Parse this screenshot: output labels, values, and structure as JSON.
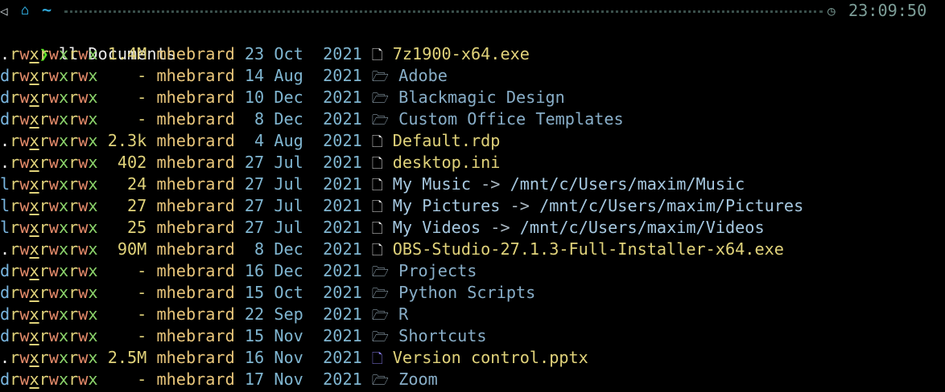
{
  "prompt": {
    "os_icon": "linux-icon",
    "home_icon": "home-icon",
    "cwd": "~",
    "time": "23:09:50",
    "clock_icon": "clock-icon",
    "chevron": "❯",
    "command": "ll Documents"
  },
  "columns": [
    "permissions",
    "size",
    "owner",
    "day",
    "month",
    "year",
    "icon",
    "name"
  ],
  "rows": [
    {
      "type": ".",
      "perms": "rwxrwxrwx",
      "size": "1.4M",
      "owner": "mhebrard",
      "day": "23",
      "month": "Oct",
      "year": "2021",
      "icon": "file-icon",
      "name": "7z1900-x64.exe",
      "kind": "file",
      "target": ""
    },
    {
      "type": "d",
      "perms": "rwxrwxrwx",
      "size": "-",
      "owner": "mhebrard",
      "day": "14",
      "month": "Aug",
      "year": "2021",
      "icon": "folder-icon",
      "name": "Adobe",
      "kind": "dir",
      "target": ""
    },
    {
      "type": "d",
      "perms": "rwxrwxrwx",
      "size": "-",
      "owner": "mhebrard",
      "day": "10",
      "month": "Dec",
      "year": "2021",
      "icon": "folder-icon",
      "name": "Blackmagic Design",
      "kind": "dir",
      "target": ""
    },
    {
      "type": "d",
      "perms": "rwxrwxrwx",
      "size": "-",
      "owner": "mhebrard",
      "day": "8",
      "month": "Dec",
      "year": "2021",
      "icon": "folder-icon",
      "name": "Custom Office Templates",
      "kind": "dir",
      "target": ""
    },
    {
      "type": ".",
      "perms": "rwxrwxrwx",
      "size": "2.3k",
      "owner": "mhebrard",
      "day": "4",
      "month": "Aug",
      "year": "2021",
      "icon": "file-icon",
      "name": "Default.rdp",
      "kind": "file",
      "target": ""
    },
    {
      "type": ".",
      "perms": "rwxrwxrwx",
      "size": "402",
      "owner": "mhebrard",
      "day": "27",
      "month": "Jul",
      "year": "2021",
      "icon": "file-icon",
      "name": "desktop.ini",
      "kind": "file",
      "target": ""
    },
    {
      "type": "l",
      "perms": "rwxrwxrwx",
      "size": "24",
      "owner": "mhebrard",
      "day": "27",
      "month": "Jul",
      "year": "2021",
      "icon": "file-icon",
      "name": "My Music",
      "kind": "link",
      "target": "/mnt/c/Users/maxim/Music"
    },
    {
      "type": "l",
      "perms": "rwxrwxrwx",
      "size": "27",
      "owner": "mhebrard",
      "day": "27",
      "month": "Jul",
      "year": "2021",
      "icon": "file-icon",
      "name": "My Pictures",
      "kind": "link",
      "target": "/mnt/c/Users/maxim/Pictures"
    },
    {
      "type": "l",
      "perms": "rwxrwxrwx",
      "size": "25",
      "owner": "mhebrard",
      "day": "27",
      "month": "Jul",
      "year": "2021",
      "icon": "file-icon",
      "name": "My Videos",
      "kind": "link",
      "target": "/mnt/c/Users/maxim/Videos"
    },
    {
      "type": ".",
      "perms": "rwxrwxrwx",
      "size": "90M",
      "owner": "mhebrard",
      "day": "8",
      "month": "Dec",
      "year": "2021",
      "icon": "file-icon",
      "name": "OBS-Studio-27.1.3-Full-Installer-x64.exe",
      "kind": "file",
      "target": ""
    },
    {
      "type": "d",
      "perms": "rwxrwxrwx",
      "size": "-",
      "owner": "mhebrard",
      "day": "16",
      "month": "Dec",
      "year": "2021",
      "icon": "folder-icon",
      "name": "Projects",
      "kind": "dir",
      "target": ""
    },
    {
      "type": "d",
      "perms": "rwxrwxrwx",
      "size": "-",
      "owner": "mhebrard",
      "day": "15",
      "month": "Oct",
      "year": "2021",
      "icon": "folder-icon",
      "name": "Python Scripts",
      "kind": "dir",
      "target": ""
    },
    {
      "type": "d",
      "perms": "rwxrwxrwx",
      "size": "-",
      "owner": "mhebrard",
      "day": "22",
      "month": "Sep",
      "year": "2021",
      "icon": "folder-icon",
      "name": "R",
      "kind": "dir",
      "target": ""
    },
    {
      "type": "d",
      "perms": "rwxrwxrwx",
      "size": "-",
      "owner": "mhebrard",
      "day": "15",
      "month": "Nov",
      "year": "2021",
      "icon": "folder-icon",
      "name": "Shortcuts",
      "kind": "dir",
      "target": ""
    },
    {
      "type": ".",
      "perms": "rwxrwxrwx",
      "size": "2.5M",
      "owner": "mhebrard",
      "day": "16",
      "month": "Nov",
      "year": "2021",
      "icon": "powerpoint-file-icon",
      "name": "Version control.pptx",
      "kind": "file",
      "target": ""
    },
    {
      "type": "d",
      "perms": "rwxrwxrwx",
      "size": "-",
      "owner": "mhebrard",
      "day": "17",
      "month": "Nov",
      "year": "2021",
      "icon": "folder-icon",
      "name": "Zoom",
      "kind": "dir",
      "target": ""
    }
  ],
  "link_arrow": "->",
  "colors": {
    "background": "#000000",
    "chevron": "#5cdd27",
    "cwd": "#2fa5d6",
    "time": "#7d9e98",
    "file_name": "#e0d27a",
    "dir_name": "#88aec8",
    "owner": "#e8c57a",
    "date": "#7fb5d0",
    "perm_read": "#e0d27a",
    "perm_write": "#e58b6a",
    "perm_exec": "#8bd36a",
    "ppt_icon": "#8a7ff0"
  }
}
